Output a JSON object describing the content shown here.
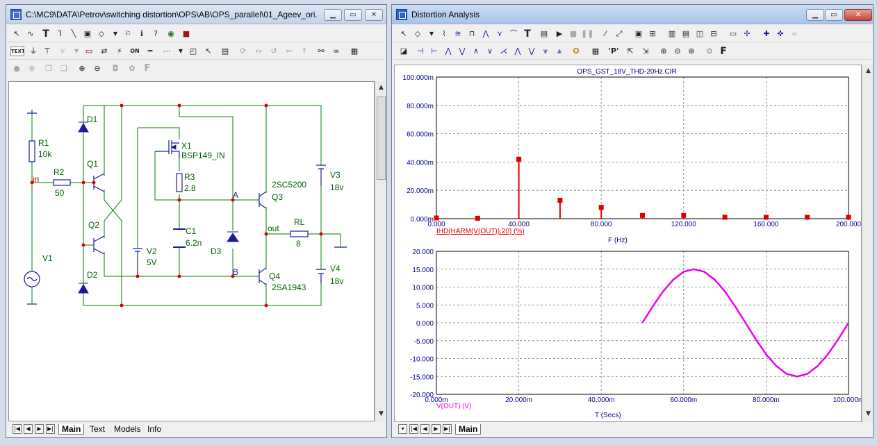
{
  "schematic_window": {
    "title": "C:\\MC9\\DATA\\Petrov\\switching distortion\\OPS\\AB\\OPS_parallel\\01_Ageev_ori...",
    "tabs": [
      "Main",
      "Text",
      "Models",
      "Info"
    ],
    "components": {
      "r1_name": "R1",
      "r1_value": "10k",
      "r2_name": "R2",
      "r2_value": "50",
      "r3_name": "R3",
      "r3_value": "2.8",
      "rl_name": "RL",
      "rl_value": "8",
      "c1_name": "C1",
      "c1_value": "6.2n",
      "x1_name": "X1",
      "x1_model": "BSP149_IN",
      "q1_name": "Q1",
      "q2_name": "Q2",
      "q3_name": "Q3",
      "q3_model": "2SC5200",
      "q4_name": "Q4",
      "q4_model": "2SA1943",
      "d1_name": "D1",
      "d2_name": "D2",
      "d3_name": "D3",
      "v1_name": "V1",
      "v2_name": "V2",
      "v2_value": "5V",
      "v3_name": "V3",
      "v3_value": "18v",
      "v4_name": "V4",
      "v4_value": "18v",
      "node_in": "in",
      "node_out": "out",
      "node_a": "A",
      "node_b": "B"
    }
  },
  "analysis_window": {
    "title": "Distortion Analysis",
    "tabs": [
      "Main"
    ],
    "toolbar_text": {
      "text_tool": "T",
      "p_tool": "'P'",
      "font_tool": "F"
    }
  },
  "colors": {
    "wire": "#007f00",
    "component": "#1a1aa0",
    "node": "#dd0000",
    "label": "#006400",
    "harmonics": "#e00000",
    "waveform": "#ee00ee",
    "axis": "#00008b"
  },
  "chart_data": [
    {
      "type": "bar",
      "title": "OPS_GST_18V_THD-20Hz.CIR",
      "xlabel": "F (Hz)",
      "ylabel": "IHD(HARM(V(OUT)),20) (%)",
      "x_tick_labels": [
        "0.000",
        "40.000",
        "80.000",
        "120.000",
        "160.000",
        "200.000"
      ],
      "y_tick_labels": [
        "0.000m",
        "20.000m",
        "40.000m",
        "60.000m",
        "80.000m",
        "100.000m"
      ],
      "xlim": [
        0,
        200
      ],
      "ylim": [
        0,
        100
      ],
      "grid": true,
      "series": [
        {
          "name": "IHD(HARM(V(OUT)),20) (%)",
          "x": [
            0,
            20,
            40,
            60,
            80,
            100,
            120,
            140,
            160,
            180,
            200
          ],
          "values": [
            0.5,
            0.3,
            42,
            13,
            8,
            2.3,
            2.3,
            1,
            1,
            1,
            1
          ]
        }
      ]
    },
    {
      "type": "line",
      "xlabel": "T (Secs)",
      "ylabel": "V(OUT) (V)",
      "x_tick_labels": [
        "0.000m",
        "20.000m",
        "40.000m",
        "60.000m",
        "80.000m",
        "100.000m"
      ],
      "y_tick_labels": [
        "20.000",
        "15.000",
        "10.000",
        "5.000",
        "0.000",
        "-5.000",
        "-10.000",
        "-15.000",
        "-20.000"
      ],
      "xlim": [
        0,
        100
      ],
      "ylim": [
        -20,
        20
      ],
      "grid": true,
      "series": [
        {
          "name": "V(OUT) (V)",
          "x": [
            50,
            52.5,
            55,
            57.5,
            60,
            62.5,
            65,
            67.5,
            70,
            72.5,
            75,
            77.5,
            80,
            82.5,
            85,
            87.5,
            90,
            92.5,
            95,
            97.5,
            100
          ],
          "values": [
            0,
            4.6,
            8.8,
            12.1,
            14.3,
            15,
            14.3,
            12.1,
            8.8,
            4.6,
            0,
            -4.6,
            -8.8,
            -12.1,
            -14.3,
            -15,
            -14.3,
            -12.1,
            -8.8,
            -4.6,
            0
          ]
        }
      ]
    }
  ]
}
